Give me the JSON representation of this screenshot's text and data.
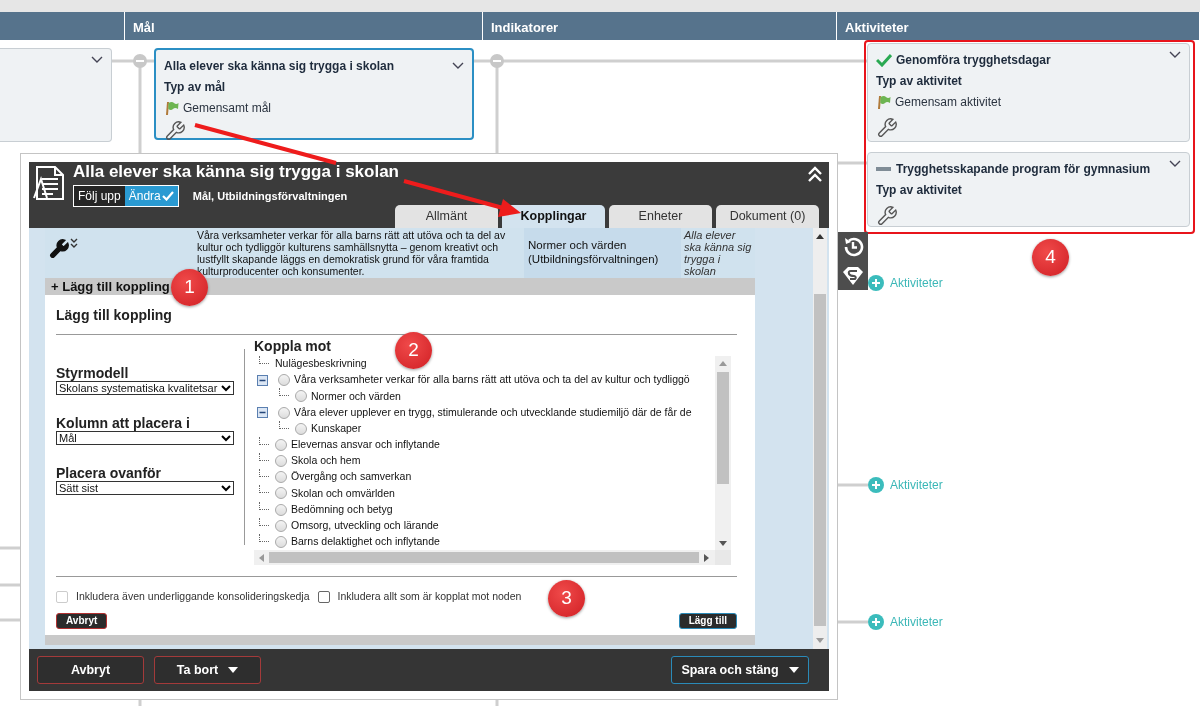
{
  "board": {
    "columns": [
      "Mål",
      "Indikatorer",
      "Aktiviteter"
    ],
    "goal_card": {
      "title": "Alla elever ska känna sig trygga i skolan",
      "type_label": "Typ av mål",
      "type_value": "Gemensamt mål"
    },
    "activities": [
      {
        "kind": "done",
        "title": "Genomföra trygghetsdagar",
        "type_label": "Typ av aktivitet",
        "type_value": "Gemensam aktivitet"
      },
      {
        "kind": "pending",
        "title": "Trygghetsskapande program för gymnasium",
        "type_label": "Typ av aktivitet"
      }
    ],
    "add_buttons": [
      "Aktiviteter",
      "Aktiviteter",
      "Aktiviteter"
    ]
  },
  "dialog": {
    "title": "Alla elever ska känna sig trygga i skolan",
    "mode_toggle": [
      {
        "label": "Följ upp",
        "selected": false
      },
      {
        "label": "Ändra",
        "selected": true
      }
    ],
    "subtitle": "Mål, Utbildningsförvaltningen",
    "tabs": [
      {
        "label": "Allmänt",
        "selected": false
      },
      {
        "label": "Kopplingar",
        "selected": true
      },
      {
        "label": "Enheter",
        "selected": false
      },
      {
        "label": "Dokument (0)",
        "selected": false
      }
    ],
    "connection": {
      "description": "Våra verksamheter verkar för alla barns rätt att utöva och ta del av kultur och tydliggör kulturens samhällsnytta – genom kreativt och lustfyllt skapande läggs en demokratisk grund för våra framtida kulturproducenter och konsumenter.",
      "target": "Normer och värden (Utbildningsförvaltningen)",
      "source": "Alla elever ska känna sig trygga i skolan"
    },
    "add_bar": "+ Lägg till koppling",
    "form": {
      "title": "Lägg till koppling",
      "fields": [
        {
          "label": "Styrmodell",
          "value": "Skolans systematiska kvalitetsar"
        },
        {
          "label": "Kolumn att placera i",
          "value": "Mål"
        },
        {
          "label": "Placera ovanför",
          "value": "Sätt sist"
        }
      ],
      "tree_title": "Koppla mot",
      "tree": [
        {
          "kind": "heading",
          "label": "Nulägesbeskrivning"
        },
        {
          "kind": "option",
          "label": "Våra verksamheter verkar för alla barns rätt att utöva och ta del av kultur och tydliggö",
          "selected": false,
          "expanded": true,
          "children": [
            {
              "kind": "option",
              "label": "Normer och värden",
              "selected": false
            }
          ]
        },
        {
          "kind": "option",
          "label": "Våra elever upplever en trygg, stimulerande och utvecklande studiemiljö där de får de",
          "selected": false,
          "expanded": true,
          "children": [
            {
              "kind": "option",
              "label": "Kunskaper",
              "selected": false
            }
          ]
        },
        {
          "kind": "option",
          "label": "Elevernas ansvar och inflytande",
          "selected": false
        },
        {
          "kind": "option",
          "label": "Skola och hem",
          "selected": false
        },
        {
          "kind": "option",
          "label": "Övergång och samverkan",
          "selected": false
        },
        {
          "kind": "option",
          "label": "Skolan och omvärlden",
          "selected": false
        },
        {
          "kind": "option",
          "label": "Bedömning och betyg",
          "selected": false
        },
        {
          "kind": "option",
          "label": "Omsorg, utveckling och lärande",
          "selected": false
        },
        {
          "kind": "option",
          "label": "Barns delaktighet och inflytande",
          "selected": false
        }
      ],
      "checks": [
        {
          "label": "Inkludera även underliggande konsolideringskedja",
          "checked": false,
          "disabled": true
        },
        {
          "label": "Inkludera allt som är kopplat mot noden",
          "checked": false,
          "disabled": false
        }
      ],
      "cancel": "Avbryt",
      "add": "Lägg till"
    },
    "footer": [
      {
        "label": "Avbryt",
        "dropdown": false,
        "kind": "danger"
      },
      {
        "label": "Ta bort",
        "dropdown": true,
        "kind": "danger"
      },
      {
        "label": "Spara och stäng",
        "dropdown": true,
        "kind": "primary"
      }
    ]
  },
  "step_markers": [
    "1",
    "2",
    "3",
    "4"
  ]
}
